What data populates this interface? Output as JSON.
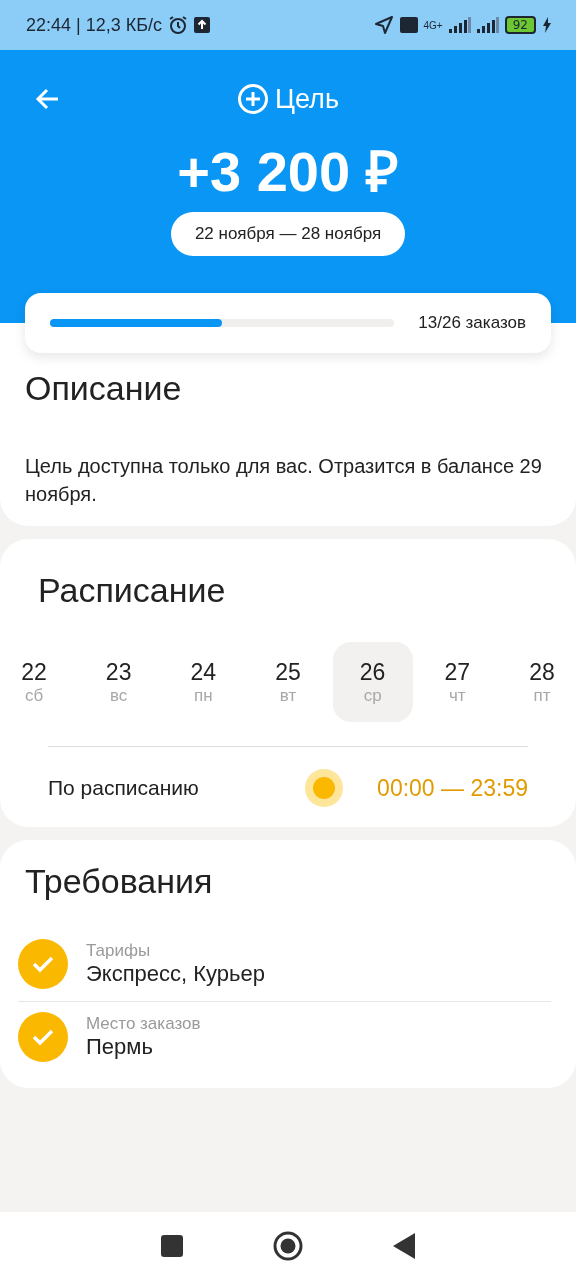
{
  "status_bar": {
    "time_speed": "22:44 | 12,3 КБ/с",
    "network": "4G+",
    "battery": "92"
  },
  "header": {
    "title": "Цель",
    "amount": "+3 200 ₽",
    "period": "22 ноября — 28 ноября"
  },
  "progress": {
    "level": 0.5,
    "label": "13/26 заказов"
  },
  "description": {
    "title": "Описание",
    "text": "Цель доступна только для вас. Отразится в балансе 29 ноября."
  },
  "schedule": {
    "title": "Расписание",
    "days": [
      {
        "date": "22",
        "weekday": "сб",
        "selected": false
      },
      {
        "date": "23",
        "weekday": "вс",
        "selected": false
      },
      {
        "date": "24",
        "weekday": "пн",
        "selected": false
      },
      {
        "date": "25",
        "weekday": "вт",
        "selected": false
      },
      {
        "date": "26",
        "weekday": "ср",
        "selected": true
      },
      {
        "date": "27",
        "weekday": "чт",
        "selected": false
      },
      {
        "date": "28",
        "weekday": "пт",
        "selected": false
      }
    ],
    "row": {
      "label": "По расписанию",
      "time": "00:00 — 23:59"
    }
  },
  "requirements": {
    "title": "Требования",
    "items": [
      {
        "label": "Тарифы",
        "value": "Экспресс, Курьер",
        "checked": true
      },
      {
        "label": "Место заказов",
        "value": "Пермь",
        "checked": true
      }
    ]
  }
}
